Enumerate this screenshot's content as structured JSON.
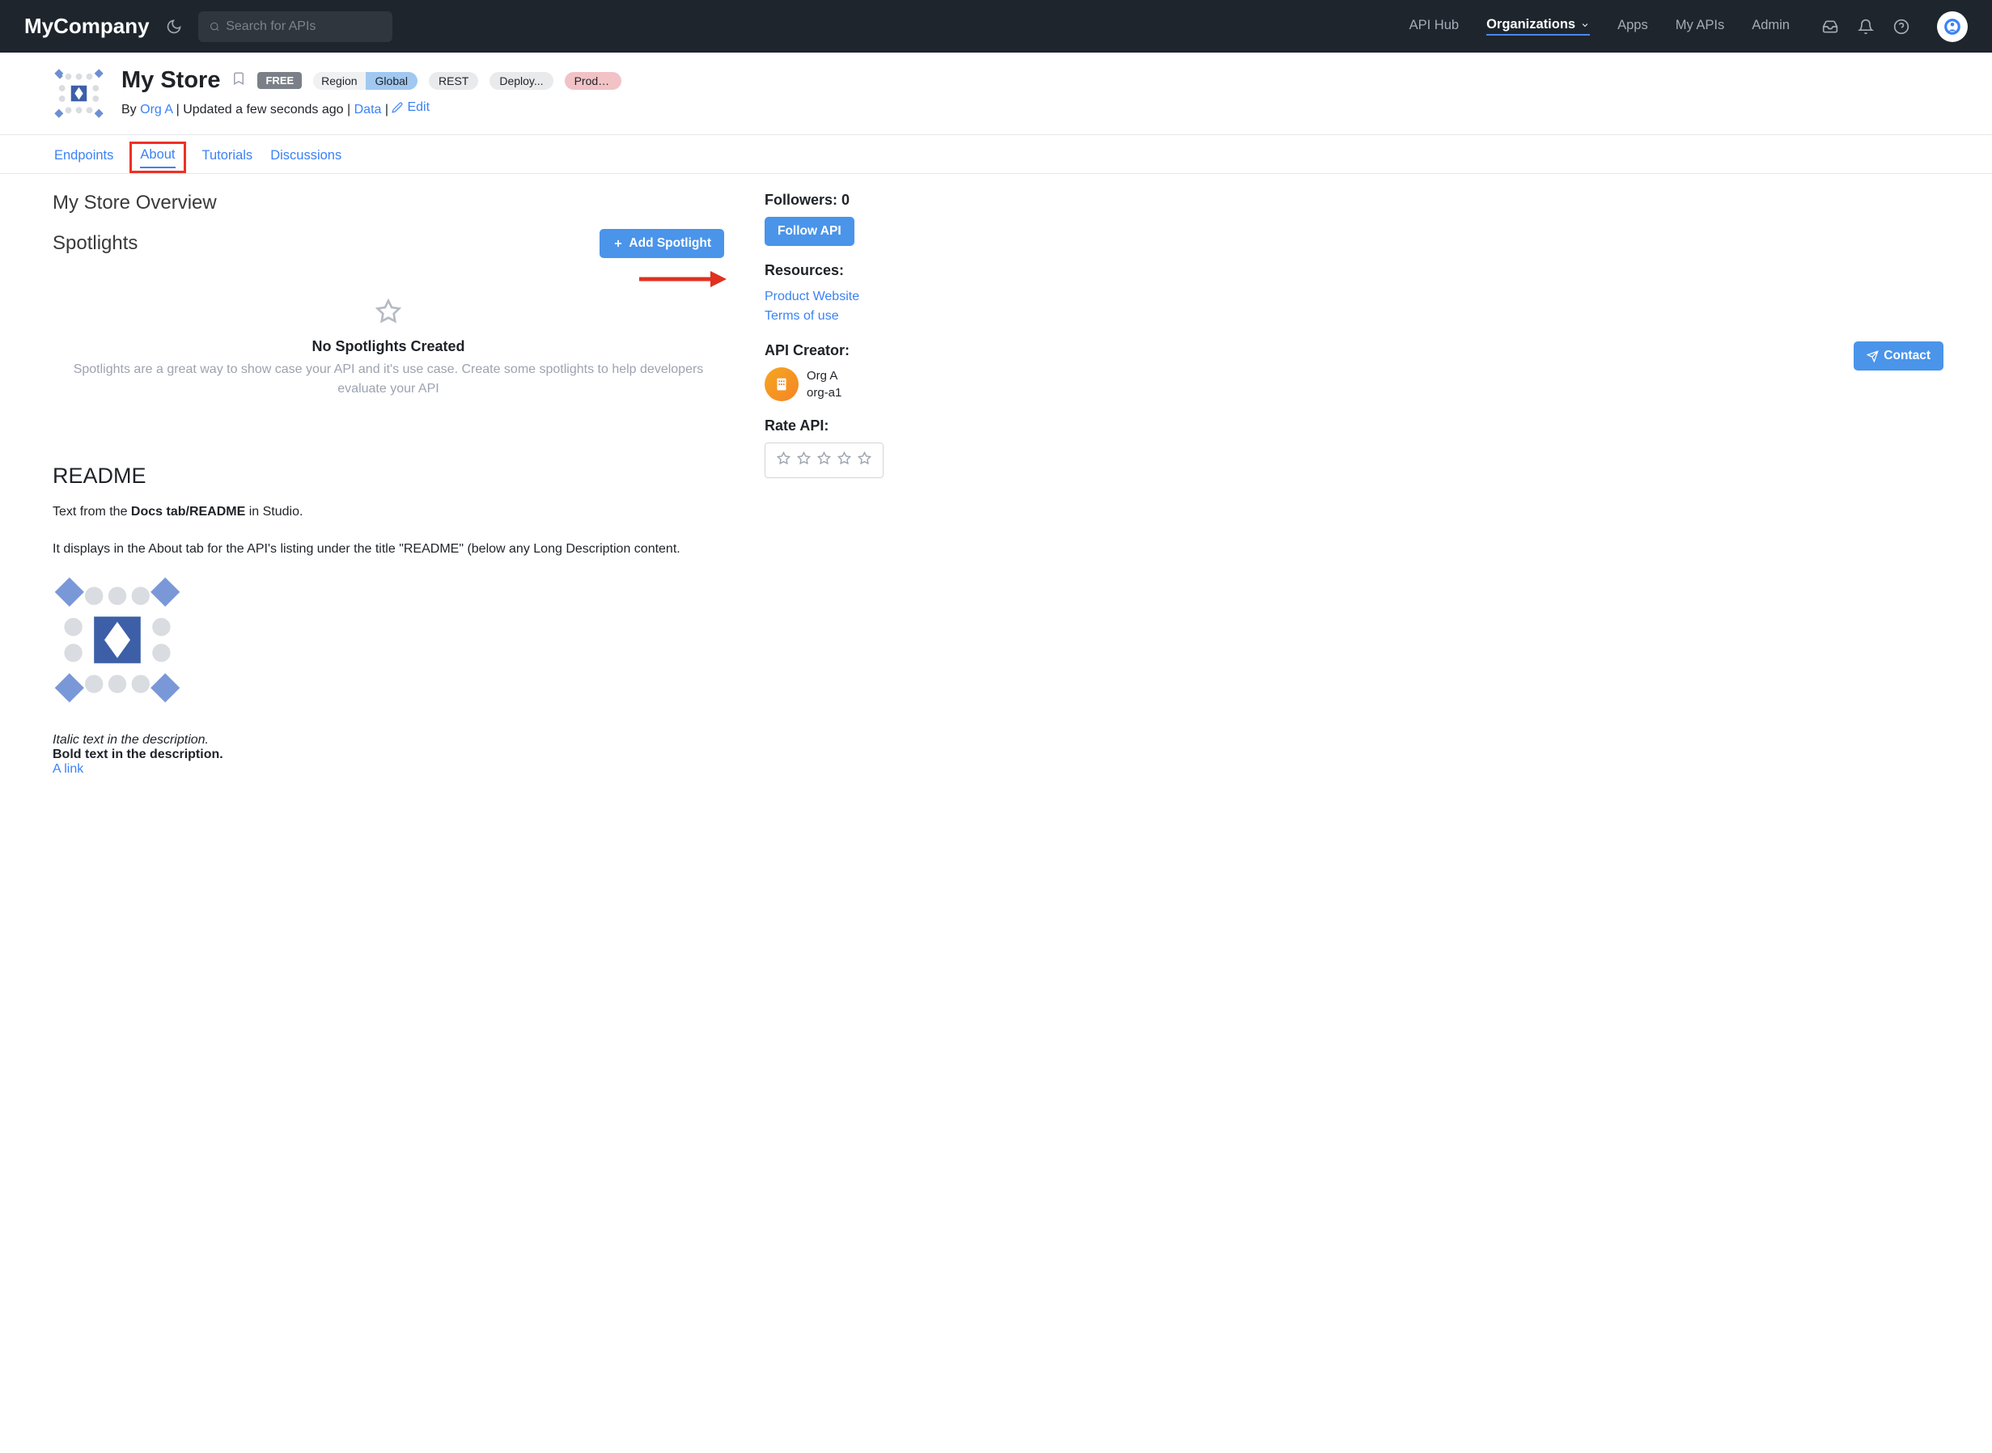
{
  "header": {
    "logo": "MyCompany",
    "search_placeholder": "Search for APIs",
    "nav": {
      "api_hub": "API Hub",
      "organizations": "Organizations",
      "apps": "Apps",
      "my_apis": "My APIs",
      "admin": "Admin"
    }
  },
  "api": {
    "title": "My Store",
    "badge_free": "FREE",
    "region_label": "Region",
    "region_value": "Global",
    "pill_rest": "REST",
    "pill_deploy": "Deploy...",
    "pill_product": "Produc...",
    "subtitle_by": "By ",
    "subtitle_org": "Org A",
    "subtitle_sep1": " | ",
    "subtitle_updated": "Updated a few seconds ago",
    "subtitle_sep2": " | ",
    "subtitle_data": "Data",
    "subtitle_sep3": " | ",
    "subtitle_edit": "Edit"
  },
  "tabs": {
    "endpoints": "Endpoints",
    "about": "About",
    "tutorials": "Tutorials",
    "discussions": "Discussions"
  },
  "overview": {
    "title": "My Store Overview",
    "spotlights_title": "Spotlights",
    "add_spotlight": "Add Spotlight",
    "empty_title": "No Spotlights Created",
    "empty_desc": "Spotlights are a great way to show case your API and it's use case. Create some spotlights to help developers evaluate your API"
  },
  "readme": {
    "heading": "README",
    "text1_prefix": "Text from the ",
    "text1_bold": "Docs tab/README",
    "text1_suffix": " in Studio.",
    "text2": "It displays in the About tab for the API's listing under the title \"README\" (below any Long Description content.",
    "italic": "Italic text in the description.",
    "bold": "Bold text in the description.",
    "link": "A link"
  },
  "sidebar": {
    "followers_label": "Followers: ",
    "followers_count": "0",
    "follow_btn": "Follow API",
    "resources_title": "Resources:",
    "product_website": "Product Website",
    "terms": "Terms of use",
    "creator_title": "API Creator:",
    "creator_name": "Org A",
    "creator_id": "org-a1",
    "rate_title": "Rate API:",
    "contact": "Contact"
  }
}
